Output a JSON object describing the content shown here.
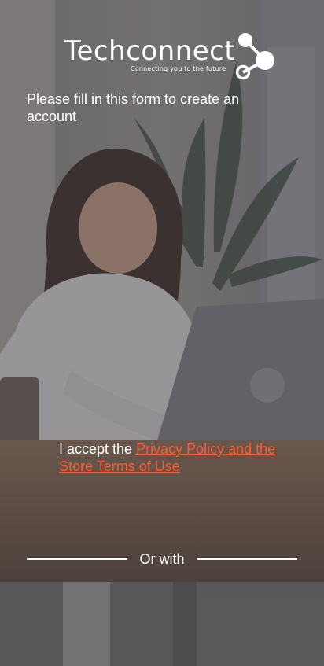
{
  "header": {
    "brand_name": "Techconnect",
    "tagline": "Connecting you to the future"
  },
  "form": {
    "intro_text": "Please fill in this form to create an account"
  },
  "terms": {
    "prefix": "I accept the",
    "link_label": "Privacy Policy and the Store Terms of Use"
  },
  "divider": {
    "label": "Or with"
  },
  "colors": {
    "link": "#ff5a2e",
    "text": "#ffffff"
  },
  "icons": {
    "logo": "share-nodes-icon",
    "background": "woman-with-laptop-photo"
  }
}
